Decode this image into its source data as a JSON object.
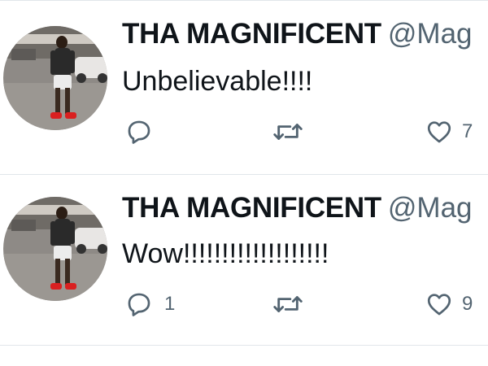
{
  "colors": {
    "name": "#0f1419",
    "secondary": "#536471",
    "divider": "#e1e6ea",
    "background": "#ffffff"
  },
  "tweets": [
    {
      "display_name": "THA MAGNIFICENT",
      "handle": "@Mag",
      "text": "Unbelievable!!!!",
      "reply_count": "",
      "retweet_count": "",
      "like_count": "7",
      "icons": [
        "avatar",
        "reply-icon",
        "retweet-icon",
        "like-icon"
      ]
    },
    {
      "display_name": "THA MAGNIFICENT",
      "handle": "@Mag",
      "text": "Wow!!!!!!!!!!!!!!!!!!!",
      "reply_count": "1",
      "retweet_count": "",
      "like_count": "9",
      "icons": [
        "avatar",
        "reply-icon",
        "retweet-icon",
        "like-icon"
      ]
    }
  ]
}
